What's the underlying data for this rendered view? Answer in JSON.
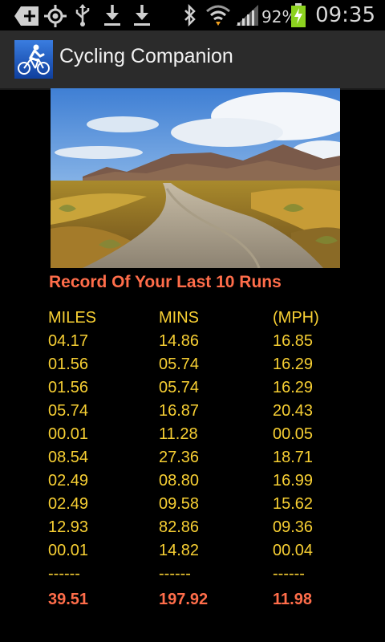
{
  "status_bar": {
    "battery": "92%",
    "time": "09:35",
    "icons": [
      "add-icon",
      "gps-icon",
      "usb-icon",
      "download-icon",
      "download-icon",
      "bluetooth-icon",
      "wifi-icon",
      "signal-icon",
      "battery-charging-icon"
    ]
  },
  "app": {
    "title": "Cycling Companion"
  },
  "main": {
    "headline": "Record Of Your Last 10 Runs",
    "columns": [
      "MILES",
      "MINS",
      "(MPH)"
    ],
    "rows": [
      [
        "04.17",
        "14.86",
        "16.85"
      ],
      [
        "01.56",
        "05.74",
        "16.29"
      ],
      [
        "01.56",
        "05.74",
        "16.29"
      ],
      [
        "05.74",
        "16.87",
        "20.43"
      ],
      [
        "00.01",
        "11.28",
        "00.05"
      ],
      [
        "08.54",
        "27.36",
        "18.71"
      ],
      [
        "02.49",
        "08.80",
        "16.99"
      ],
      [
        "02.49",
        "09.58",
        "15.62"
      ],
      [
        "12.93",
        "82.86",
        "09.36"
      ],
      [
        "00.01",
        "14.82",
        "00.04"
      ]
    ],
    "separator": [
      "------",
      "------",
      "------"
    ],
    "totals": [
      "39.51",
      "197.92",
      "11.98"
    ]
  },
  "colors": {
    "accent": "#ff6d4a",
    "value_text": "#f7cf33",
    "action_bar": "#2b2b2b"
  }
}
